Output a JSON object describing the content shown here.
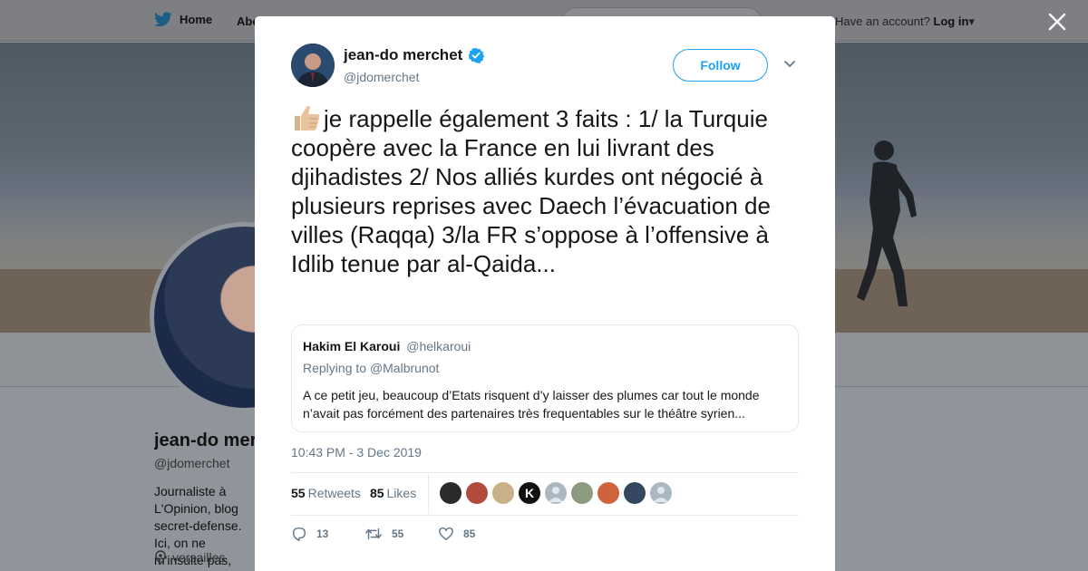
{
  "nav": {
    "home_label": "Home",
    "about_label": "About",
    "account_prompt": "Have an account?",
    "login_label": "Log in"
  },
  "background_profile": {
    "name": "jean-do merchet",
    "handle": "@jdomerchet",
    "bio": "Journaliste à L'Opinion, blog secret-defense. Ici, on ne m'insulte pas, sinon je bloque.",
    "location": "versailles"
  },
  "tweet": {
    "author_name": "jean-do merchet",
    "author_handle": "@jdomerchet",
    "follow_label": "Follow",
    "text": "je rappelle également 3 faits : 1/ la Turquie coopère avec la France en lui livrant des djihadistes 2/ Nos alliés kurdes ont négocié à plusieurs reprises avec Daech l’évacuation de villes (Raqqa) 3/la FR s’oppose à l’offensive à Idlib tenue par al-Qaida...",
    "timestamp": "10:43 PM - 3 Dec 2019",
    "retweets_count": "55",
    "retweets_label": "Retweets",
    "likes_count": "85",
    "likes_label": "Likes",
    "reply_count": "13",
    "retweet_action_count": "55",
    "like_action_count": "85"
  },
  "quoted_tweet": {
    "name": "Hakim El Karoui",
    "handle": "@helkaroui",
    "replying_prefix": "Replying to",
    "replying_to": "@Malbrunot",
    "text": "A ce petit jeu, beaucoup d’Etats risquent d’y laisser des plumes car tout le monde n’avait pas forcément des partenaires très frequentables sur le théâtre syrien..."
  },
  "likers": [
    "#2b2b2b",
    "#b34a3e",
    "#c9b088",
    "#111111",
    "#aab8c2",
    "#8c9a7e",
    "#d0623f",
    "#33475f",
    "#aab8c2"
  ],
  "colors": {
    "accent": "#1da1f2",
    "verified": "#1da1f2",
    "muted": "#657786"
  }
}
